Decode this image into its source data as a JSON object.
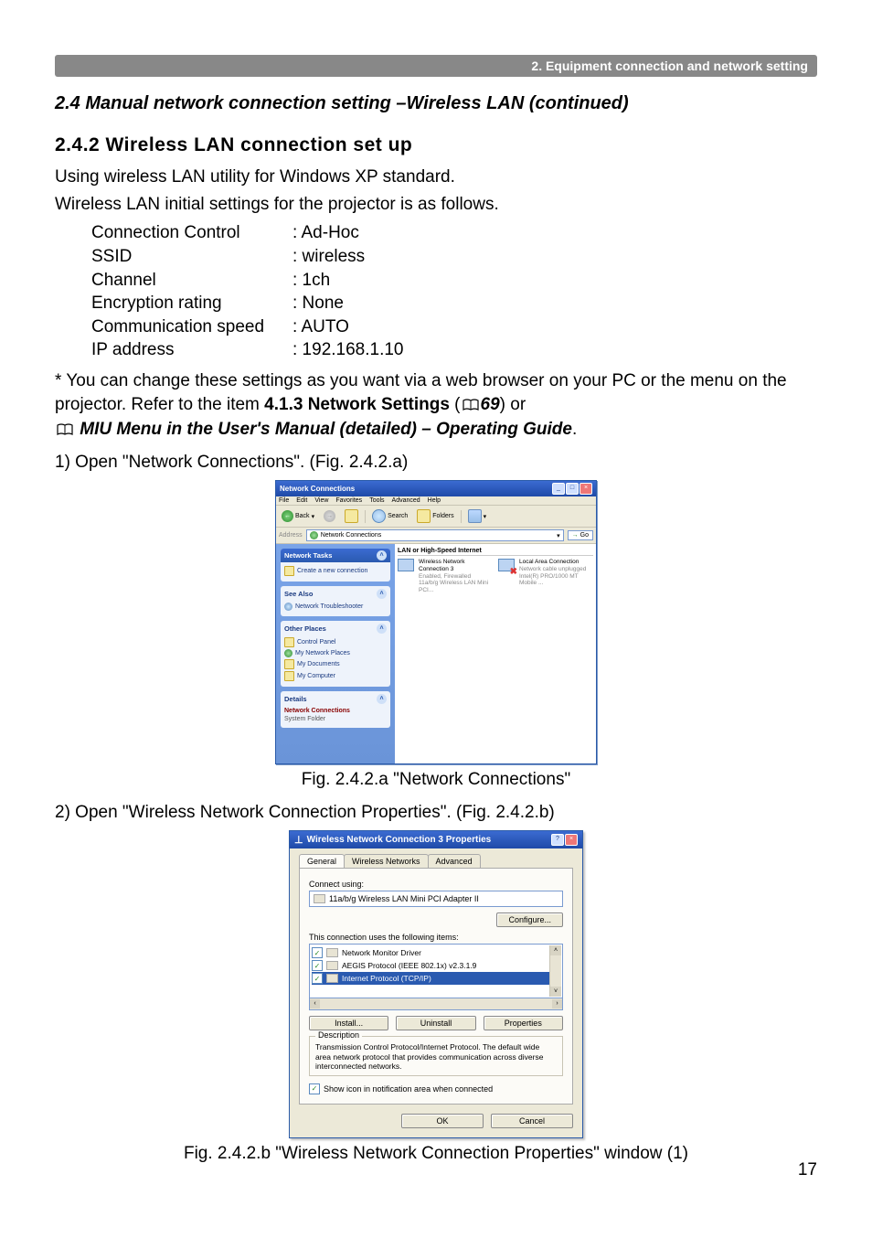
{
  "header_bar": "2. Equipment connection and network setting",
  "section_title": "2.4 Manual network connection setting –Wireless LAN (continued)",
  "subsection_title": "2.4.2 Wireless LAN connection set up",
  "intro_line_1": "Using wireless LAN utility for Windows XP standard.",
  "intro_line_2": "Wireless LAN initial settings for the projector is as follows.",
  "settings": [
    {
      "label": "Connection Control",
      "value": ": Ad-Hoc"
    },
    {
      "label": "SSID",
      "value": ": wireless"
    },
    {
      "label": "Channel",
      "value": ": 1ch"
    },
    {
      "label": "Encryption rating",
      "value": ": None"
    },
    {
      "label": "Communication speed",
      "value": ": AUTO"
    },
    {
      "label": "IP address",
      "value": ": 192.168.1.10"
    }
  ],
  "note_prefix": "* You can change these settings as you want via a web browser on your PC or the menu on the projector. Refer to the item ",
  "note_bold": "4.1.3 Network Settings",
  "note_paren_open": " (",
  "note_page_ref": "69",
  "note_paren_close": ") or ",
  "note_italic": "MIU Menu in the User's Manual (detailed) – Operating Guide",
  "note_period": ".",
  "step1": "1) Open \"Network Connections\". (Fig. 2.4.2.a)",
  "fig1_caption": "Fig. 2.4.2.a \"Network Connections\"",
  "step2": "2) Open \"Wireless Network Connection Properties\". (Fig. 2.4.2.b)",
  "fig2_caption": "Fig. 2.4.2.b \"Wireless Network Connection Properties\" window (1)",
  "page_number": "17",
  "fig1": {
    "title": "Network Connections",
    "menus": [
      "File",
      "Edit",
      "View",
      "Favorites",
      "Tools",
      "Advanced",
      "Help"
    ],
    "toolbar": {
      "back": "Back",
      "search": "Search",
      "folders": "Folders"
    },
    "address_label": "Address",
    "address_value": "Network Connections",
    "go": "Go",
    "side": {
      "tasks_head": "Network Tasks",
      "tasks_item": "Create a new connection",
      "see_also_head": "See Also",
      "see_also_item": "Network Troubleshooter",
      "other_head": "Other Places",
      "other_items": [
        "Control Panel",
        "My Network Places",
        "My Documents",
        "My Computer"
      ],
      "details_head": "Details",
      "details_line1": "Network Connections",
      "details_line2": "System Folder"
    },
    "content": {
      "group": "LAN or High-Speed Internet",
      "conn1": {
        "l1": "Wireless Network Connection 3",
        "l2": "Enabled, Firewalled",
        "l3": "11a/b/g Wireless LAN Mini PCI..."
      },
      "conn2": {
        "l1": "Local Area Connection",
        "l2": "Network cable unplugged",
        "l3": "Intel(R) PRO/1000 MT Mobile ..."
      }
    }
  },
  "fig2": {
    "title": "Wireless Network Connection 3 Properties",
    "tabs": [
      "General",
      "Wireless Networks",
      "Advanced"
    ],
    "connect_using_label": "Connect using:",
    "adapter": "11a/b/g Wireless LAN Mini PCI Adapter II",
    "configure": "Configure...",
    "items_label": "This connection uses the following items:",
    "items": [
      "Network Monitor Driver",
      "AEGIS Protocol (IEEE 802.1x) v2.3.1.9",
      "Internet Protocol (TCP/IP)"
    ],
    "install": "Install...",
    "uninstall": "Uninstall",
    "properties": "Properties",
    "desc_head": "Description",
    "desc_body": "Transmission Control Protocol/Internet Protocol. The default wide area network protocol that provides communication across diverse interconnected networks.",
    "show_icon": "Show icon in notification area when connected",
    "ok": "OK",
    "cancel": "Cancel"
  }
}
